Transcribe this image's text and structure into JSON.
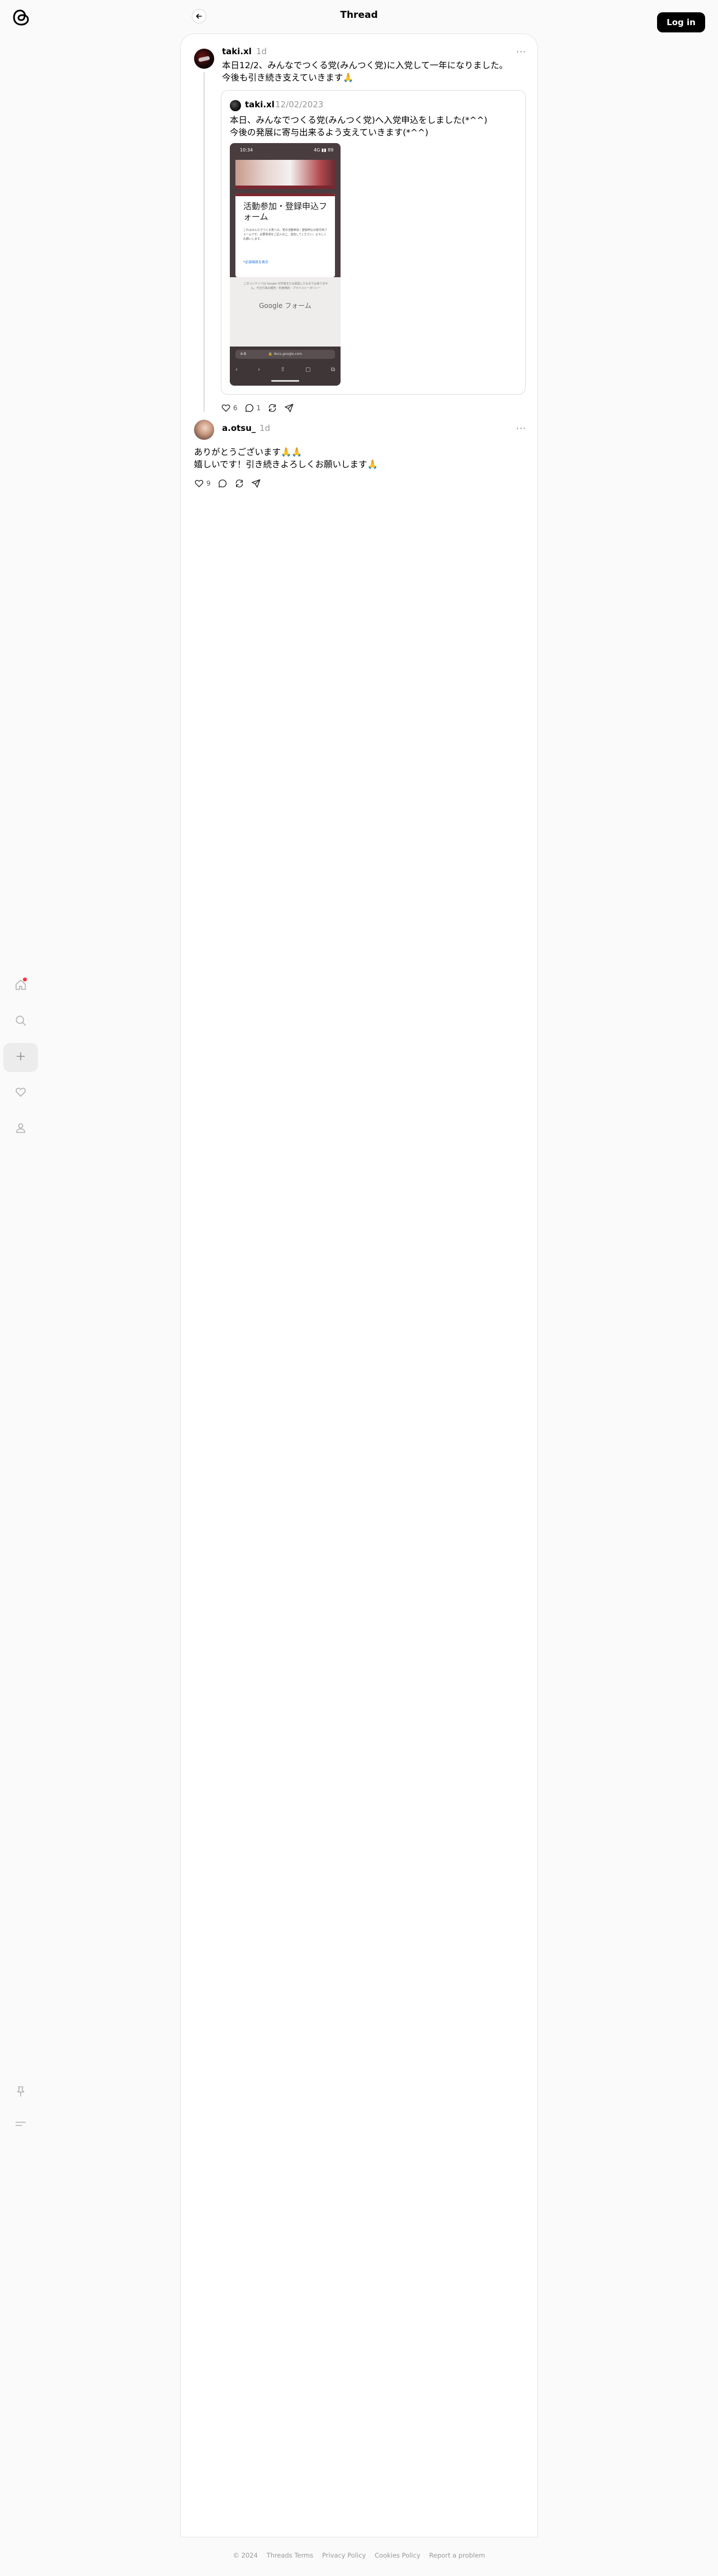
{
  "header": {
    "title": "Thread",
    "login_label": "Log in"
  },
  "posts": [
    {
      "username": "taki.xl",
      "time": "1d",
      "text": "本日12/2、みんなでつくる党(みんつく党)に入党して一年になりました。\n今後も引き続き支えていきます🙏",
      "likes": "6",
      "replies": "1",
      "quote": {
        "username": "taki.xl",
        "time": "12/02/2023",
        "text": "本日、みんなでつくる党(みんつく党)へ入党申込をしました(*^^)\n今後の発展に寄与出来るよう支えていきます(*^^)",
        "screenshot": {
          "status_time": "10:34",
          "status_right": "4G ▮▮ 89",
          "form_title": "活動参加・登録申込フォーム",
          "form_desc": "これはみんなでつくる党への、党の活動参加・登録申込の受付用フォームです。必要事項をご記入の上、送信してください。よろしくお願いします。",
          "required_label": "*必須項目を表示",
          "note": "このコンテンツは Google が作成または承認したものではありません。不正行為の報告・利用規約・プライバシーポリシー",
          "brand": "Google フォーム",
          "aa_label": "ぁあ",
          "url": "🔒 docs.google.com",
          "nav_icons": [
            "‹",
            "›",
            "⇧",
            "▢",
            "⧉"
          ]
        }
      }
    },
    {
      "username": "a.otsu_",
      "time": "1d",
      "text": "ありがとうございます🙏🙏\n嬉しいです！引き続きよろしくお願いします🙏",
      "likes": "9"
    }
  ],
  "footer": {
    "copyright": "© 2024",
    "links": [
      "Threads Terms",
      "Privacy Policy",
      "Cookies Policy",
      "Report a problem"
    ]
  },
  "icons": {
    "logo": "threads-logo-icon",
    "nav": [
      "home-icon",
      "search-icon",
      "create-icon",
      "activity-heart-icon",
      "profile-icon"
    ],
    "bottom": [
      "pin-icon",
      "menu-icon"
    ],
    "post_actions": [
      "like-icon",
      "reply-icon",
      "repost-icon",
      "share-icon"
    ]
  },
  "colors": {
    "notification_dot": "#ff3040",
    "login_button": "#000000",
    "muted_text": "#999999"
  }
}
